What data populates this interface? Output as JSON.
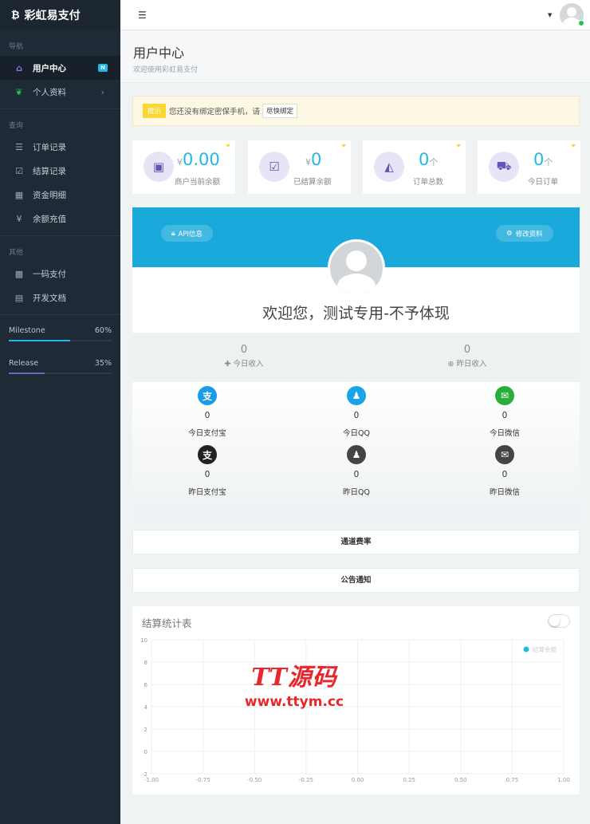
{
  "sidebar": {
    "brand": "彩虹易支付",
    "brand_icon": "bitcoin-icon",
    "sections": [
      {
        "title": "导航",
        "items": [
          {
            "label": "用户中心",
            "icon": "home-icon",
            "active": true,
            "badge": "N"
          },
          {
            "label": "个人资料",
            "icon": "leaf-icon",
            "chevron": true
          }
        ]
      },
      {
        "title": "查询",
        "items": [
          {
            "label": "订单记录",
            "icon": "list-icon"
          },
          {
            "label": "结算记录",
            "icon": "check-square-icon"
          },
          {
            "label": "资金明细",
            "icon": "calendar-icon"
          },
          {
            "label": "余额充值",
            "icon": "yen-icon"
          }
        ]
      },
      {
        "title": "其他",
        "items": [
          {
            "label": "一码支付",
            "icon": "qrcode-icon"
          },
          {
            "label": "开发文档",
            "icon": "book-icon"
          }
        ]
      }
    ],
    "progress": [
      {
        "label": "Milestone",
        "value": "60%",
        "fraction": 0.6,
        "color": "#23b7e5"
      },
      {
        "label": "Release",
        "value": "35%",
        "fraction": 0.35,
        "color": "#7266ba"
      }
    ]
  },
  "header": {
    "menu_icon": "indent-icon",
    "caret_icon": "caret-down-icon"
  },
  "page": {
    "title": "用户中心",
    "subtitle": "欢迎使用彩虹易支付"
  },
  "alert": {
    "tag": "提示",
    "text": "您还没有绑定密保手机，请",
    "button": "尽快绑定"
  },
  "stats": [
    {
      "prefix": "¥",
      "value": "0.00",
      "suffix": "",
      "label": "商户当前余额",
      "icon": "money-icon",
      "glyph": "▣"
    },
    {
      "prefix": "¥",
      "value": "0",
      "suffix": "",
      "label": "已结算余额",
      "icon": "check-icon",
      "glyph": "☑"
    },
    {
      "prefix": "",
      "value": "0",
      "suffix": "个",
      "label": "订单总数",
      "icon": "area-chart-icon",
      "glyph": "◭"
    },
    {
      "prefix": "",
      "value": "0",
      "suffix": "个",
      "label": "今日订单",
      "icon": "cart-icon",
      "glyph": "⛟"
    }
  ],
  "profile": {
    "api_button": "API信息",
    "edit_button": "修改资料",
    "welcome": "欢迎您，测试专用-不予体现",
    "today_income": {
      "value": "0",
      "label": "今日收入"
    },
    "yesterday_income": {
      "value": "0",
      "label": "昨日收入"
    },
    "payments": [
      {
        "value": "0",
        "label": "今日支付宝",
        "icon": "alipay-icon",
        "glyph": "支",
        "color": "#1a9be6"
      },
      {
        "value": "0",
        "label": "今日QQ",
        "icon": "qq-icon",
        "glyph": "♟",
        "color": "#1aa3e8"
      },
      {
        "value": "0",
        "label": "今日微信",
        "icon": "wechat-icon",
        "glyph": "✉",
        "color": "#2aae3a"
      },
      {
        "value": "0",
        "label": "昨日支付宝",
        "icon": "alipay-icon",
        "glyph": "支",
        "color": "#222222"
      },
      {
        "value": "0",
        "label": "昨日QQ",
        "icon": "qq-icon",
        "glyph": "♟",
        "color": "#444444"
      },
      {
        "value": "0",
        "label": "昨日微信",
        "icon": "wechat-icon",
        "glyph": "✉",
        "color": "#444444"
      }
    ]
  },
  "sections": {
    "rates": "通道费率",
    "notice": "公告通知"
  },
  "chart_panel": {
    "title": "结算统计表",
    "toggle_on": false
  },
  "chart_data": {
    "type": "line",
    "title": "结算统计表",
    "x_ticks": [
      "-1.00",
      "-0.75",
      "-0.50",
      "-0.25",
      "0.00",
      "0.25",
      "0.50",
      "0.75",
      "1.00"
    ],
    "y_ticks": [
      "-2",
      "0",
      "2",
      "4",
      "6",
      "8",
      "10"
    ],
    "xlim": [
      -1,
      1
    ],
    "ylim": [
      -2,
      10
    ],
    "series": [
      {
        "name": "结算金额",
        "values": [],
        "color": "#23b7e5"
      }
    ],
    "legend": "top-right",
    "grid": true
  },
  "watermark": {
    "line1": "TT源码",
    "line2": "www.ttym.cc"
  }
}
